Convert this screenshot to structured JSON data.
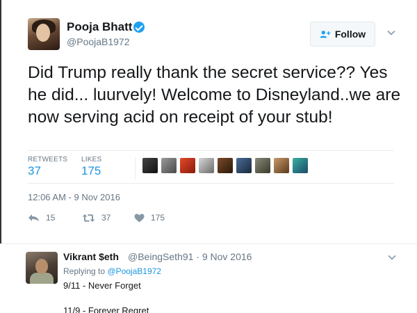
{
  "tweet": {
    "author": {
      "display_name": "Pooja Bhatt",
      "handle": "@PoojaB1972",
      "verified": true,
      "verified_icon": "verified-badge-icon"
    },
    "follow_button": {
      "label": "Follow",
      "icon": "add-user-icon"
    },
    "text": "Did Trump really thank the secret service?? Yes he did... luurvely! Welcome to Disneyland..we are now serving acid on receipt of your stub!",
    "stats": {
      "retweets_label": "RETWEETS",
      "retweets_value": "37",
      "likes_label": "LIKES",
      "likes_value": "175"
    },
    "liker_avatars": 9,
    "timestamp": "12:06 AM - 9 Nov 2016",
    "actions": {
      "reply_count": "15",
      "retweet_count": "37",
      "like_count": "175"
    }
  },
  "reply": {
    "display_name": "Vikrant $eth",
    "meta": "@BeingSeth91 · 9 Nov 2016",
    "replying_prefix": "Replying to",
    "replying_mention": "@PoojaB1972",
    "line1": "9/11 - Never Forget",
    "line2": "11/9 - Forever Regret"
  },
  "colors": {
    "accent": "#1da1f2",
    "link": "#1b95e0",
    "muted": "#657786",
    "text": "#14171a"
  }
}
